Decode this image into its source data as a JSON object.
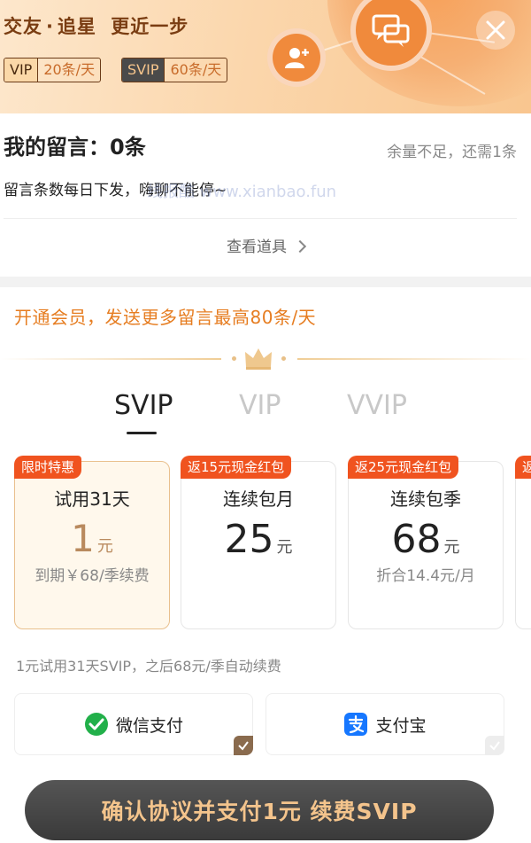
{
  "banner": {
    "slogan_part1": "交友",
    "slogan_sep": "·",
    "slogan_part2": "追星",
    "slogan_part3": "更近一步",
    "vip_tag": {
      "label": "VIP",
      "value": "20条/天"
    },
    "svip_tag": {
      "label": "SVIP",
      "value": "60条/天"
    },
    "icons": [
      "person-add-icon",
      "chat-bubbles-icon"
    ],
    "close_icon": "close-icon"
  },
  "messages": {
    "title": "我的留言：0条",
    "remain": "余量不足，还需1条",
    "desc": "留言条数每日下发，嗨聊不能停~",
    "watermark": "线报酷 www.xianbao.fun",
    "view_props": "查看道具"
  },
  "membership": {
    "promo": "开通会员，发送更多留言最高80条/天",
    "tabs": [
      {
        "label": "SVIP",
        "active": true
      },
      {
        "label": "VIP",
        "active": false
      },
      {
        "label": "VVIP",
        "active": false
      }
    ],
    "plans": [
      {
        "badge": "限时特惠",
        "name": "试用31天",
        "price": "1",
        "unit": "元",
        "sub": "到期￥68/季续费",
        "selected": true
      },
      {
        "badge": "返15元现金红包",
        "name": "连续包月",
        "price": "25",
        "unit": "元",
        "sub": "",
        "selected": false
      },
      {
        "badge": "返25元现金红包",
        "name": "连续包季",
        "price": "68",
        "unit": "元",
        "sub": "折合14.4元/月",
        "selected": false
      },
      {
        "badge": "返",
        "name": "",
        "price": "",
        "unit": "",
        "sub": "",
        "selected": false
      }
    ],
    "trial_note": "1元试用31天SVIP，之后68元/季自动续费",
    "payment": [
      {
        "label": "微信支付",
        "icon": "wechat-pay-icon",
        "selected": true
      },
      {
        "label": "支付宝",
        "icon": "alipay-icon",
        "selected": false
      }
    ],
    "cta": "确认协议并支付1元 续费SVIP"
  },
  "colors": {
    "accent_orange": "#e67d21",
    "badge_red": "#f0531f",
    "gold": "#b98a5e",
    "cta_text": "#f4c48c"
  }
}
